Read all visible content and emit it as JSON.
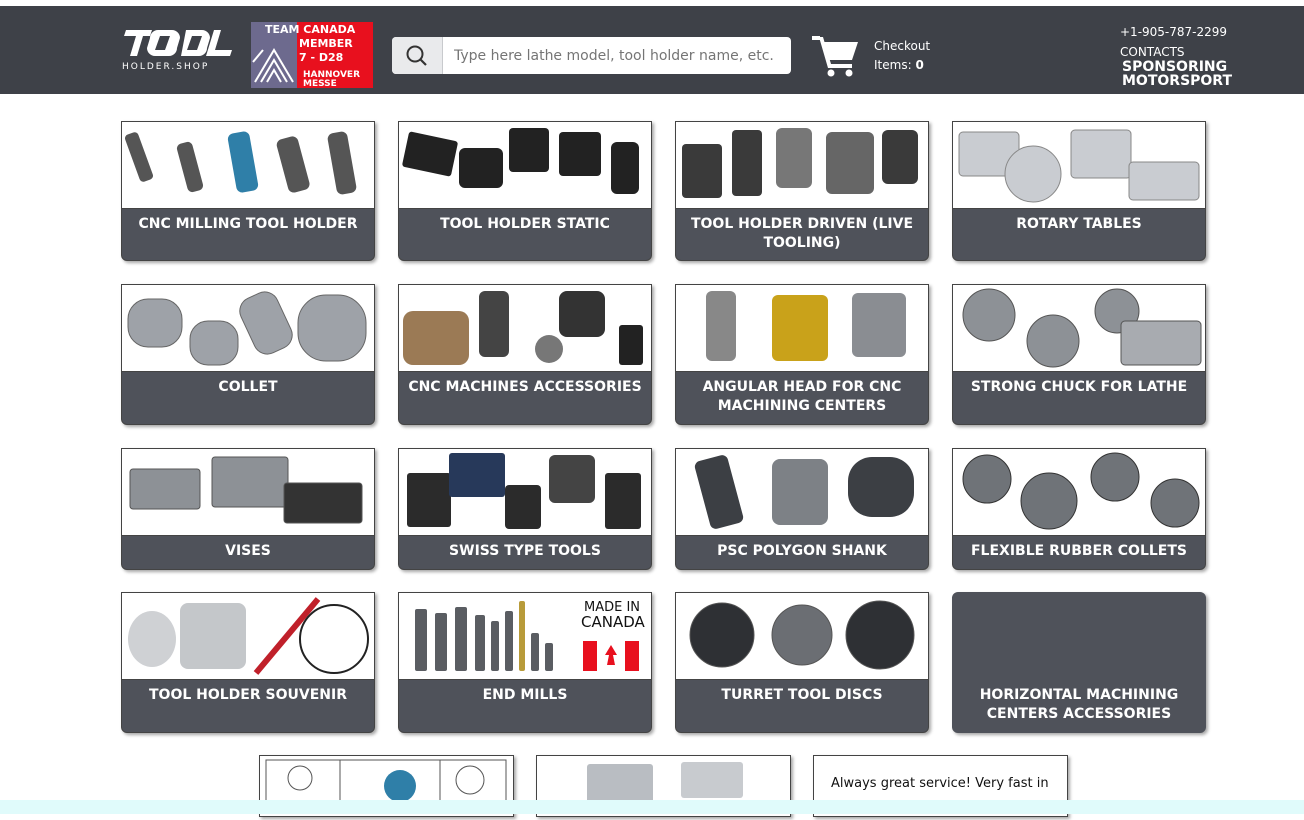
{
  "header": {
    "logo_text": "HOLDER.SHOP",
    "badge": {
      "line1": "TEAM CANADA",
      "line2": "MEMBER",
      "line3": "7 - D28",
      "line4": "HANNOVER",
      "line5": "MESSE"
    },
    "search": {
      "placeholder": "Type here lathe model, tool holder name, etc."
    },
    "cart": {
      "checkout_label": "Checkout",
      "items_label": "Items:",
      "items_count": "0"
    },
    "phone": "+1-905-787-2299",
    "contacts_label": "CONTACTS",
    "sponsor_line1": "SPONSORING",
    "sponsor_line2": "MOTORSPORT"
  },
  "categories": [
    {
      "label": "CNC MILLING TOOL HOLDER"
    },
    {
      "label": "TOOL HOLDER STATIC"
    },
    {
      "label": "TOOL HOLDER DRIVEN (LIVE TOOLING)"
    },
    {
      "label": "ROTARY TABLES"
    },
    {
      "label": "COLLET"
    },
    {
      "label": "CNC MACHINES ACCESSORIES"
    },
    {
      "label": "ANGULAR HEAD FOR CNC MACHINING CENTERS"
    },
    {
      "label": "STRONG CHUCK FOR LATHE"
    },
    {
      "label": "VISES"
    },
    {
      "label": "SWISS TYPE TOOLS"
    },
    {
      "label": "PSC POLYGON SHANK"
    },
    {
      "label": "FLEXIBLE RUBBER COLLETS"
    },
    {
      "label": "TOOL HOLDER SOUVENIR"
    },
    {
      "label": "END MILLS"
    },
    {
      "label": "TURRET TOOL DISCS"
    },
    {
      "label": "HORIZONTAL MACHINING CENTERS ACCESSORIES"
    }
  ],
  "end_mills_badge": {
    "line1": "MADE IN",
    "line2": "CANADA"
  },
  "review": {
    "text": "Always great service! Very fast in"
  },
  "colors": {
    "header_bg": "#3e4148",
    "card_bg": "#4f525a",
    "canada_red": "#e8101e"
  }
}
